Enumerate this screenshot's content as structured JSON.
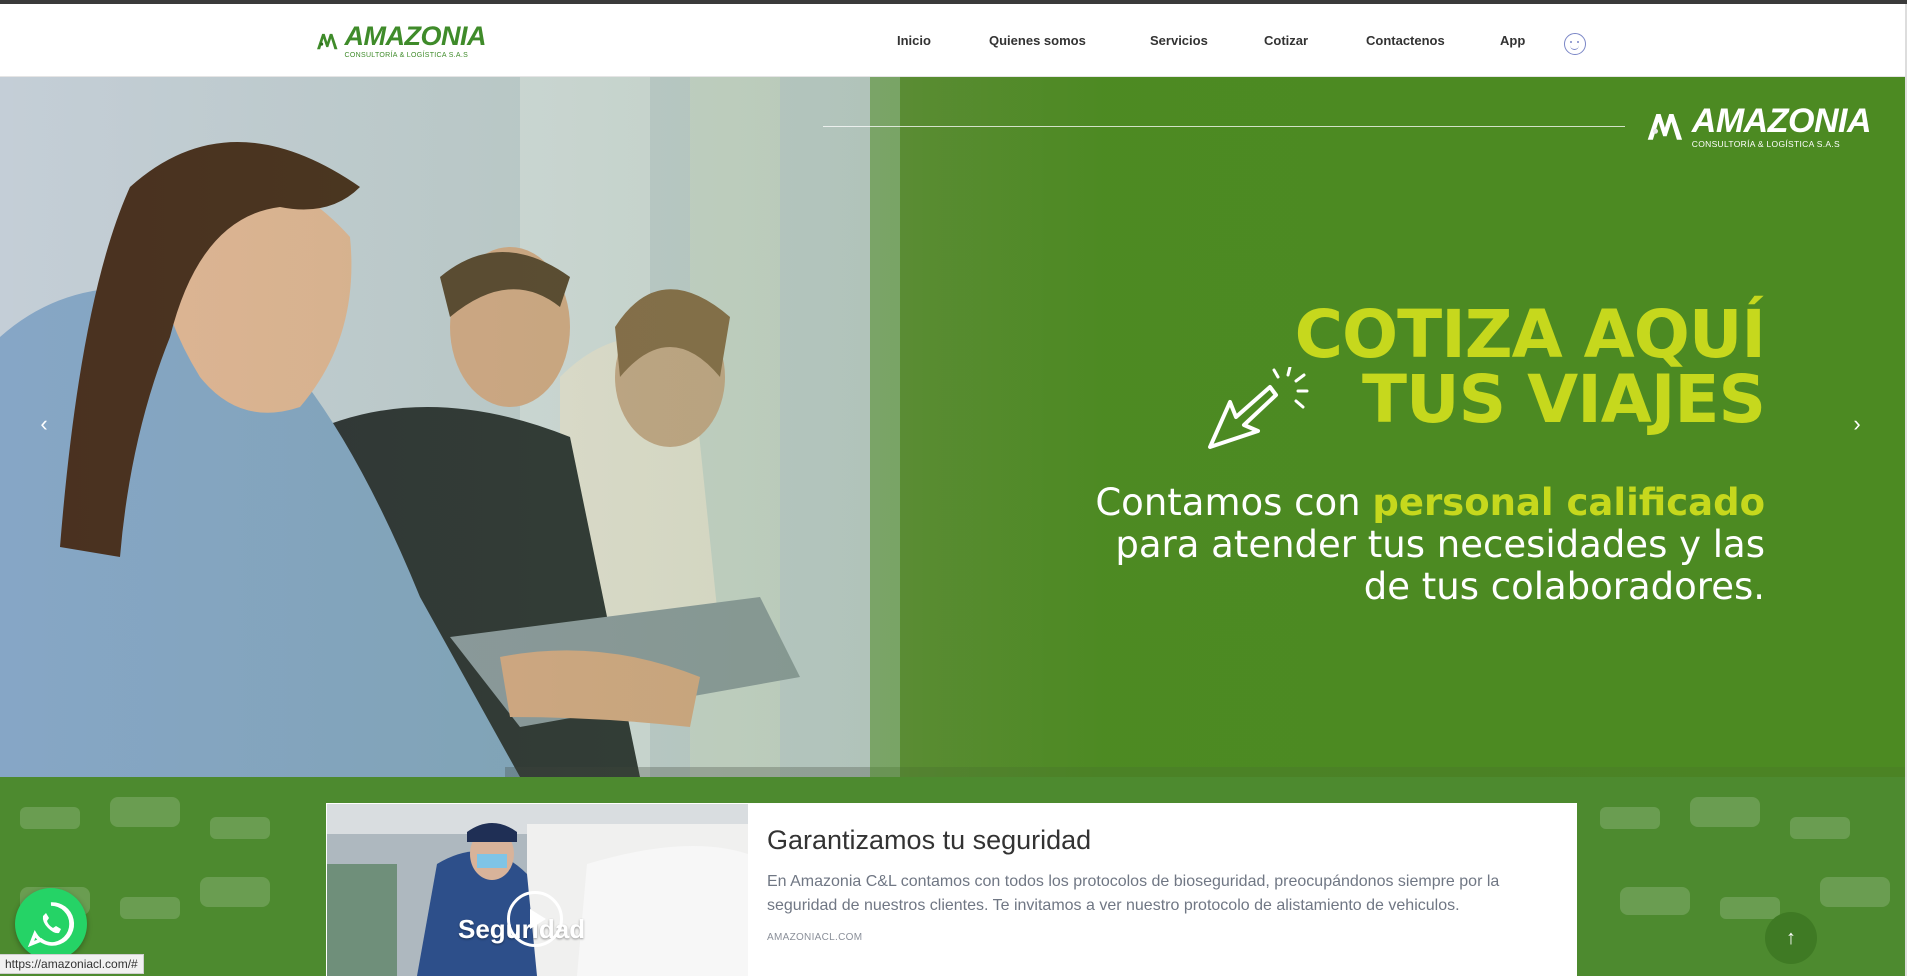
{
  "header": {
    "logo": {
      "name": "AMAZONIA",
      "subtitle": "CONSULTORÍA & LOGÍSTICA S.A.S"
    },
    "nav": [
      {
        "label": "Inicio"
      },
      {
        "label": "Quienes somos"
      },
      {
        "label": "Servicios"
      },
      {
        "label": "Cotizar"
      },
      {
        "label": "Contactenos"
      },
      {
        "label": "App"
      }
    ],
    "accessibility_icon": "face-icon"
  },
  "hero": {
    "logo": {
      "name": "AMAZONIA",
      "subtitle": "CONSULTORÍA & LOGÍSTICA S.A.S"
    },
    "cta_line1": "COTIZA AQUÍ",
    "cta_line2": "TUS VIAJES",
    "sub_line1_prefix": "Contamos con ",
    "sub_line1_highlight": "personal calificado",
    "sub_line2": "para atender tus necesidades y las",
    "sub_line3": "de tus colaboradores.",
    "prev_icon": "chevron-left-icon",
    "next_icon": "chevron-right-icon",
    "accent_color": "#c6d81d",
    "bg_color": "#4c8a22"
  },
  "card": {
    "thumb_text": "Seguridad",
    "title": "Garantizamos tu seguridad",
    "description": "En Amazonia C&L contamos con todos los protocolos de bioseguridad, preocupándonos siempre por la seguridad de nuestros clientes. Te invitamos a ver nuestro protocolo de alistamiento de vehiculos.",
    "domain": "AMAZONIACL.COM"
  },
  "floating": {
    "whatsapp_icon": "whatsapp-icon",
    "scroll_top_icon": "arrow-up-icon"
  },
  "status_bar": {
    "url": "https://amazoniacl.com/#"
  }
}
